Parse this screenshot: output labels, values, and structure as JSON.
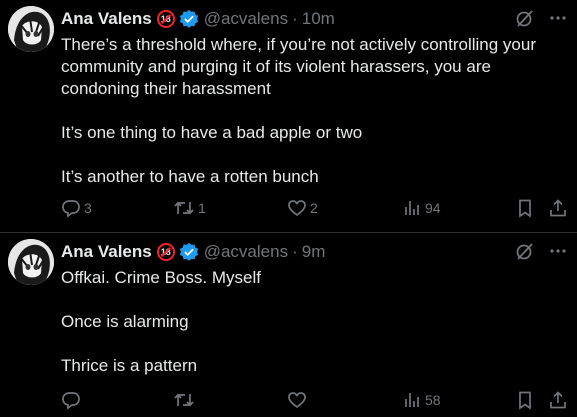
{
  "tweets": [
    {
      "author": {
        "name": "Ana Valens",
        "age_badge": "18",
        "handle": "@acvalens",
        "time": "10m"
      },
      "text": [
        "There’s a threshold where, if you’re not actively controlling your community and purging it of its violent harassers, you are condoning their harassment",
        "It’s one thing to have a bad apple or two",
        "It’s another to have a rotten bunch"
      ],
      "stats": {
        "replies": "3",
        "reposts": "1",
        "likes": "2",
        "views": "94"
      }
    },
    {
      "author": {
        "name": "Ana Valens",
        "age_badge": "18",
        "handle": "@acvalens",
        "time": "9m"
      },
      "text": [
        "Offkai. Crime Boss. Myself",
        "Once is alarming",
        "Thrice is a pattern"
      ],
      "stats": {
        "replies": "",
        "reposts": "",
        "likes": "",
        "views": "58"
      }
    }
  ],
  "colors": {
    "background": "#000000",
    "text": "#e7e9ea",
    "muted": "#71767b",
    "verified": "#1d9bf0",
    "badge": "#f4212e"
  },
  "icons": [
    "grok-icon",
    "more-icon",
    "reply-icon",
    "repost-icon",
    "like-icon",
    "views-icon",
    "bookmark-icon",
    "share-icon",
    "verified-icon"
  ]
}
